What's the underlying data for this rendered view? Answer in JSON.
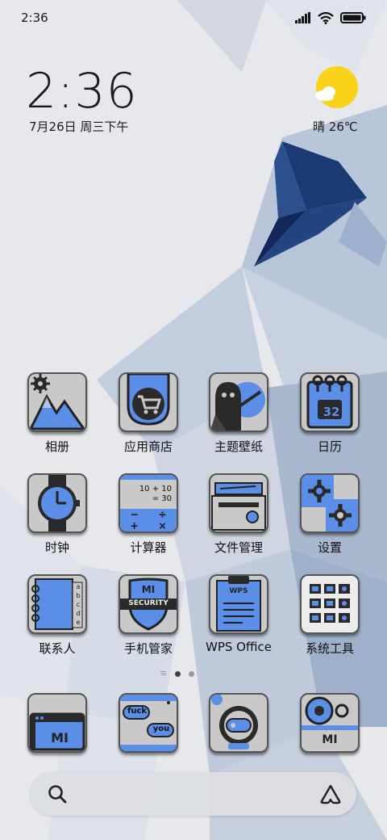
{
  "status_bar": {
    "time": "2:36",
    "icons": [
      "signal-icon",
      "wifi-icon",
      "battery-icon"
    ]
  },
  "widget": {
    "clock": "2:36",
    "date": "7月26日 周三下午",
    "weather": {
      "condition": "晴",
      "temperature": "26℃",
      "icon": "sun-cloud-icon"
    }
  },
  "apps": [
    {
      "label": "相册",
      "icon": "mountain-gear-icon"
    },
    {
      "label": "应用商店",
      "icon": "shopping-cart-icon"
    },
    {
      "label": "主题壁纸",
      "icon": "ghost-brush-icon"
    },
    {
      "label": "日历",
      "icon": "calendar-icon",
      "badge": "32"
    },
    {
      "label": "时钟",
      "icon": "watch-icon"
    },
    {
      "label": "计算器",
      "icon": "calculator-icon",
      "lines": [
        "10 + 10",
        "= 30"
      ],
      "keys": [
        "−",
        "÷",
        "+",
        "×"
      ]
    },
    {
      "label": "文件管理",
      "icon": "file-folder-icon"
    },
    {
      "label": "设置",
      "icon": "gears-icon"
    },
    {
      "label": "联系人",
      "icon": "address-book-icon",
      "tabs": [
        "a",
        "b",
        "c",
        "d",
        "e"
      ]
    },
    {
      "label": "手机管家",
      "icon": "security-shield-icon",
      "logo": "MI",
      "banner": "SECURITY"
    },
    {
      "label": "WPS Office",
      "icon": "clipboard-icon",
      "doc_text": "WPS"
    },
    {
      "label": "系统工具",
      "icon": "tools-folder-icon"
    }
  ],
  "page_indicator": {
    "pages": 2,
    "current": 1
  },
  "dock": [
    {
      "icon": "browser-mi-icon",
      "logo": "MI"
    },
    {
      "icon": "messages-icon",
      "bubbles": [
        "fuck",
        "you"
      ]
    },
    {
      "icon": "astronaut-icon"
    },
    {
      "icon": "camera-mi-icon",
      "logo": "MI"
    }
  ],
  "search_bar": {
    "icons": [
      "search-icon",
      "assistant-icon"
    ]
  },
  "colors": {
    "accent": "#5b8ee6",
    "tile": "#c9c9c9",
    "dark": "#2a2a2a",
    "sun": "#f9d21a"
  }
}
